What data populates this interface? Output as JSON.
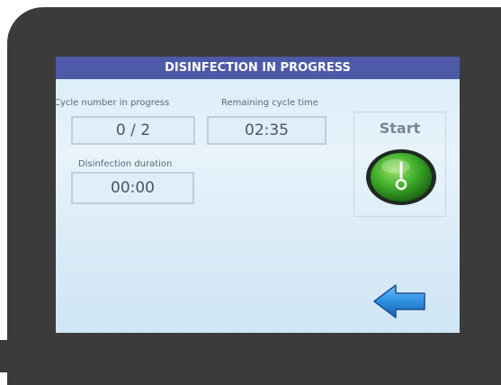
{
  "screen": {
    "title": "DISINFECTION IN PROGRESS"
  },
  "cycle_number": {
    "label": "Cycle number in progress",
    "value": "0 / 2"
  },
  "remaining_time": {
    "label": "Remaining cycle time",
    "value": "02:35"
  },
  "disinfection_duration": {
    "label": "Disinfection duration",
    "value": "00:00"
  },
  "start": {
    "label": "Start",
    "icon": "power-switch-icon"
  },
  "back": {
    "icon": "arrow-left-icon"
  },
  "colors": {
    "bezel": "#3b3b3b",
    "title_bar": "#4e59a8",
    "screen_bg": "#d8ecf8",
    "start_green": "#3fae2a",
    "back_blue": "#2f8fe0"
  }
}
